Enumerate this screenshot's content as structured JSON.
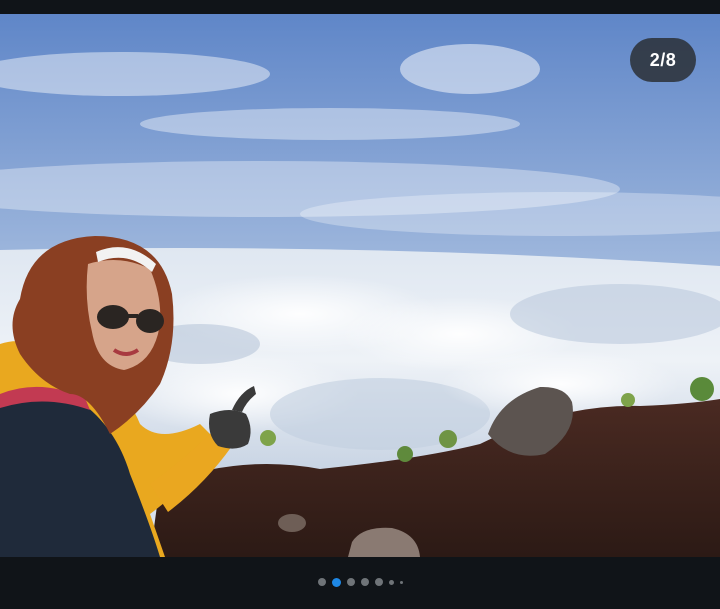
{
  "viewer": {
    "counter_text": "2/8",
    "current_index": 2,
    "total_images": 8,
    "photo_icon": "landscape-photo"
  },
  "pagination": {
    "dots": [
      "inactive",
      "active",
      "inactive",
      "inactive",
      "inactive",
      "small",
      "tiny"
    ],
    "active_color": "#1e88e5",
    "inactive_color": "#6f7478"
  },
  "colors": {
    "background": "#101418",
    "counter_bg": "#2c3034"
  }
}
